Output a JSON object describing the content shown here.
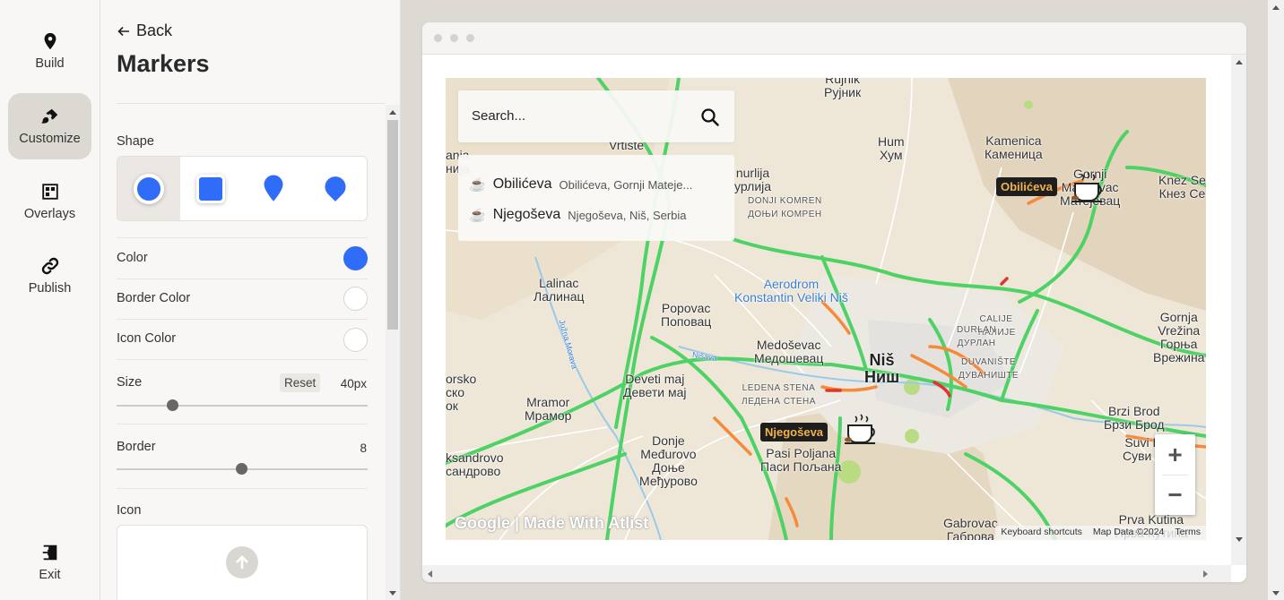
{
  "nav": {
    "items": [
      {
        "label": "Build",
        "icon": "map-pin-icon"
      },
      {
        "label": "Customize",
        "icon": "paintbrush-icon"
      },
      {
        "label": "Overlays",
        "icon": "layers-grid-icon"
      },
      {
        "label": "Publish",
        "icon": "link-icon"
      }
    ],
    "exit_label": "Exit"
  },
  "panel": {
    "back_label": "Back",
    "title": "Markers",
    "shape_label": "Shape",
    "shapes": [
      "circle",
      "square",
      "pin",
      "rounded-pin"
    ],
    "color_label": "Color",
    "color_value": "#2f6cf7",
    "border_color_label": "Border Color",
    "border_color_value": "#ffffff",
    "icon_color_label": "Icon Color",
    "icon_color_value": "#ffffff",
    "size_label": "Size",
    "reset_label": "Reset",
    "size_value": "40",
    "size_unit": "px",
    "border_label": "Border",
    "border_value": "8",
    "icon_label": "Icon"
  },
  "map": {
    "search_placeholder": "Search...",
    "results": [
      {
        "name": "Obilićeva",
        "address": "Obilićeva, Gornji Mateje..."
      },
      {
        "name": "Njegoševa",
        "address": "Njegoševa, Niš, Serbia"
      }
    ],
    "markers": [
      {
        "label": "Obilićeva"
      },
      {
        "label": "Njegoševa"
      }
    ],
    "places": [
      {
        "name": "Rujnik\nРујник"
      },
      {
        "name": "Vrtiste"
      },
      {
        "name": "Hum\nХум"
      },
      {
        "name": "Kamenica\nКаменица"
      },
      {
        "name": "Knez Se\nКнез Се"
      },
      {
        "name": "Gornji\nMatejevac\nМатејевац"
      },
      {
        "name": "nurlija\nурлија"
      },
      {
        "name": "DONJI KOMREN\nДОЊИ КОМРЕН"
      },
      {
        "name": "Lalinac\nЛалинац"
      },
      {
        "name": "Aerodrom\nKonstantin Veliki Niš"
      },
      {
        "name": "Popovac\nПоповац"
      },
      {
        "name": "CALIJE\nЋАЛИЈЕ"
      },
      {
        "name": "DURLAN\nДУРЛАН"
      },
      {
        "name": "Gornja\nVrežina\nГорња\nВрежина"
      },
      {
        "name": "Medoševac\nМедошевац"
      },
      {
        "name": "DUVANIŠTE\nДУВАНИШТЕ"
      },
      {
        "name": "Niš\nНиш"
      },
      {
        "name": "Deveti maj\nДевети мај"
      },
      {
        "name": "LEDENA STENA\nЛЕДЕНА СТЕНА"
      },
      {
        "name": "orsko\nско\nок"
      },
      {
        "name": "Mramor\nМрамор"
      },
      {
        "name": "Brzi Brod\nБрзи Брод"
      },
      {
        "name": "Donje\nMeđurovo\nДоње\nМеђурово"
      },
      {
        "name": "Pasi Poljana\nПаси Пољана"
      },
      {
        "name": "ksandrovo\nсандрово"
      },
      {
        "name": "Suvi Do\nСуви До"
      },
      {
        "name": "Gabrovac\nГаброва"
      },
      {
        "name": "Prva Kutina\nПрва Кутина"
      },
      {
        "name": "Južna Morava"
      },
      {
        "name": "Nišava"
      },
      {
        "name": "ania\nнија"
      }
    ],
    "watermark": "Google | Made With Atlist",
    "attribution": [
      "Keyboard shortcuts",
      "Map Data ©2024",
      "Terms"
    ],
    "zoom_in": "+",
    "zoom_out": "−"
  },
  "colors": {
    "accent": "#2f6cf7",
    "marker_label_bg": "#1e1e1e",
    "marker_label_text": "#f4b24a",
    "traffic_green": "#4fd265",
    "traffic_orange": "#f58a3a",
    "traffic_red": "#e0352b"
  }
}
